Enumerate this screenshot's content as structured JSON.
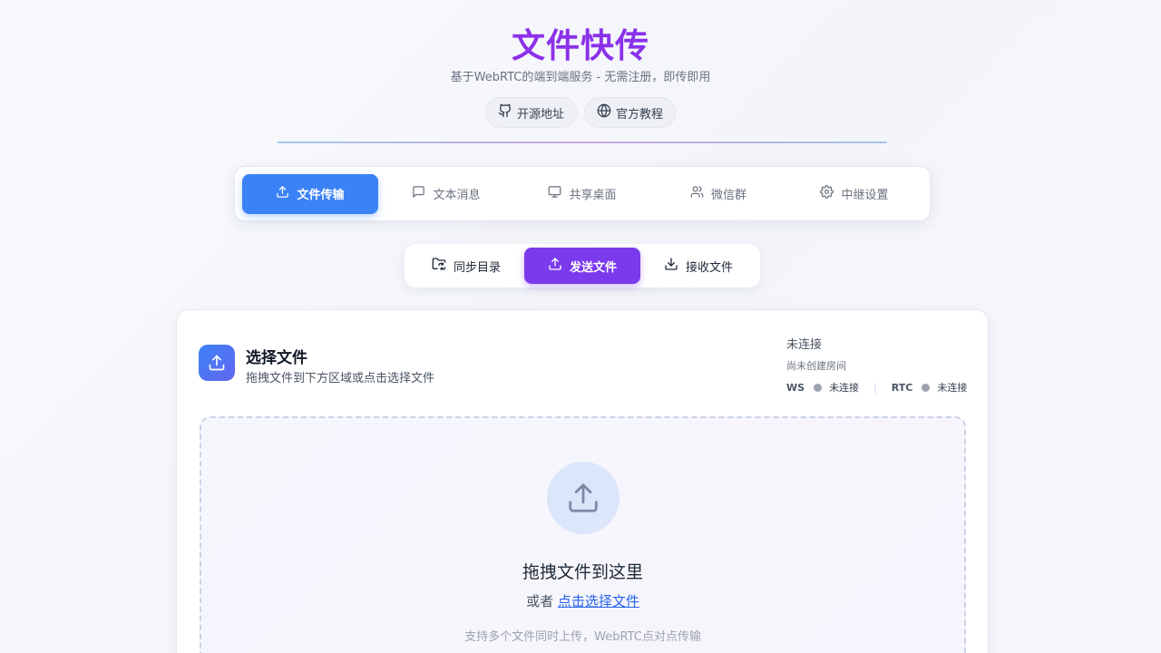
{
  "header": {
    "title": "文件快传",
    "subtitle": "基于WebRTC的端到端服务 - 无需注册，即传即用",
    "links": [
      {
        "label": "开源地址",
        "icon": "github-icon"
      },
      {
        "label": "官方教程",
        "icon": "globe-icon"
      }
    ]
  },
  "main_tabs": [
    {
      "label": "文件传输",
      "icon": "upload-icon",
      "active": true
    },
    {
      "label": "文本消息",
      "icon": "message-icon",
      "active": false
    },
    {
      "label": "共享桌面",
      "icon": "monitor-icon",
      "active": false
    },
    {
      "label": "微信群",
      "icon": "users-icon",
      "active": false
    },
    {
      "label": "中继设置",
      "icon": "gear-icon",
      "active": false
    }
  ],
  "sub_tabs": [
    {
      "label": "同步目录",
      "icon": "folder-sync-icon",
      "active": false
    },
    {
      "label": "发送文件",
      "icon": "upload-icon",
      "active": true
    },
    {
      "label": "接收文件",
      "icon": "download-icon",
      "active": false
    }
  ],
  "card": {
    "title": "选择文件",
    "description": "拖拽文件到下方区域或点击选择文件",
    "status": {
      "main": "未连接",
      "room": "尚未创建房间",
      "ws_label": "WS",
      "ws_status": "未连接",
      "separator": "|",
      "rtc_label": "RTC",
      "rtc_status": "未连接"
    }
  },
  "dropzone": {
    "title": "拖拽文件到这里",
    "or_text": "或者",
    "link_text": "点击选择文件",
    "hint": "支持多个文件同时上传，WebRTC点对点传输"
  },
  "colors": {
    "primary_blue": "#3b82f6",
    "primary_purple": "#7c3aed",
    "title_gradient_start": "#9b27e6",
    "status_gray": "#9ca3af"
  }
}
